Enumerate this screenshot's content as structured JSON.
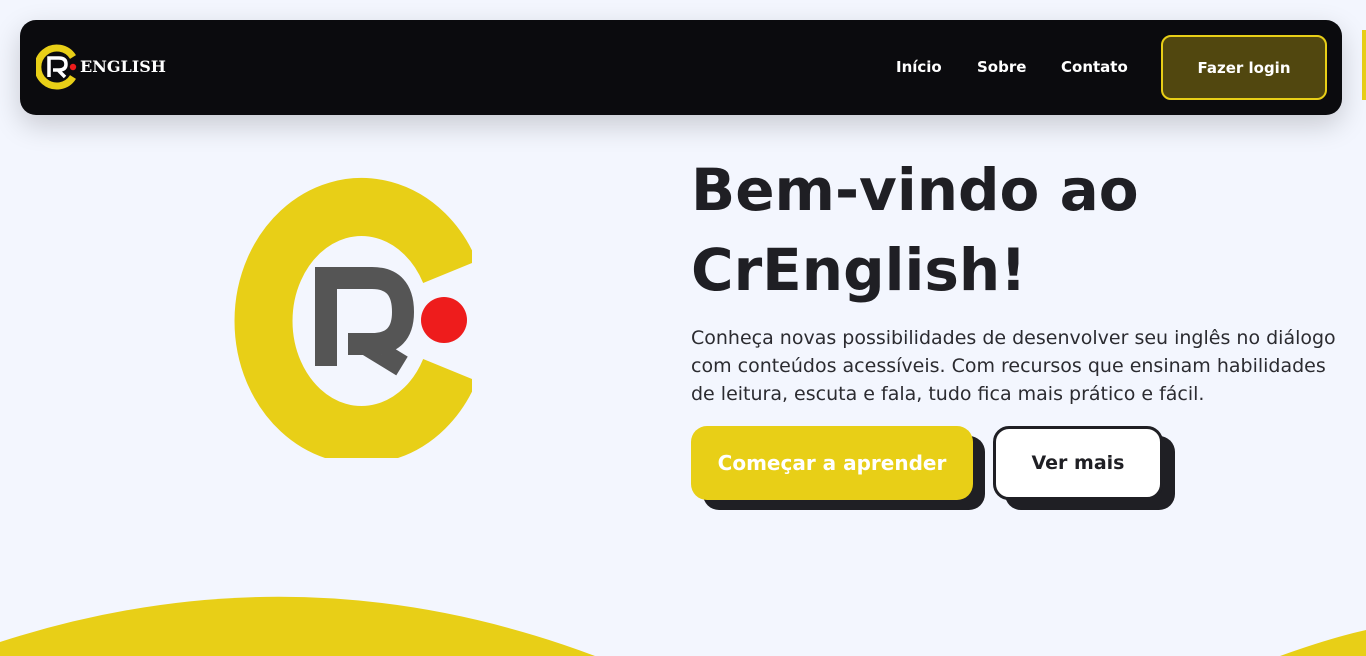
{
  "brand": {
    "logo_letter": "R",
    "name": "ENGLISH",
    "colors": {
      "yellow": "#e8cf17",
      "red": "#ee1c1c",
      "gray": "#555555"
    }
  },
  "nav": {
    "links": [
      "Início",
      "Sobre",
      "Contato"
    ],
    "login_label": "Fazer login"
  },
  "hero": {
    "title_line1": "Bem-vindo ao",
    "title_line2": "CrEnglish!",
    "description": "Conheça novas possibilidades de desenvolver seu inglês no diálogo com conteúdos acessíveis. Com recursos que ensinam habilidades de leitura, escuta e fala, tudo fica mais prático e fácil.",
    "primary_button": "Começar a aprender",
    "secondary_button": "Ver mais"
  },
  "colors": {
    "accent": "#e8cf17",
    "background": "#f3f6fe",
    "navbar": "#0b0b0e",
    "text": "#1f1f24"
  }
}
